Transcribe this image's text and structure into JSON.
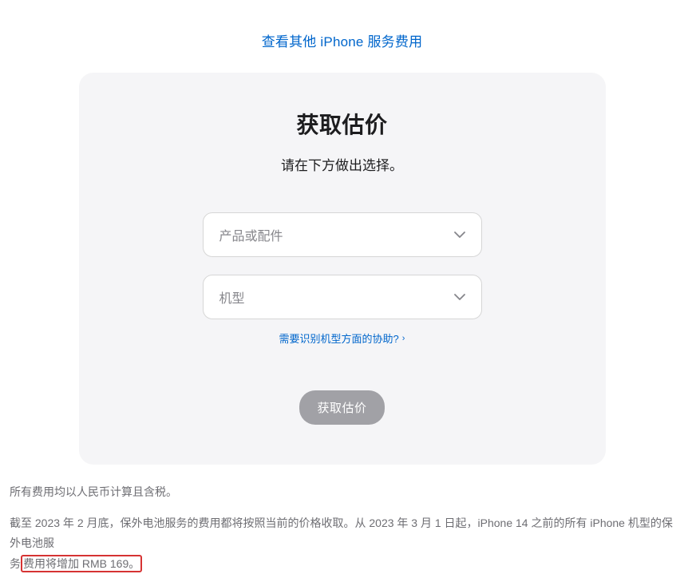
{
  "top_link": {
    "label": "查看其他 iPhone 服务费用"
  },
  "card": {
    "title": "获取估价",
    "subtitle": "请在下方做出选择。",
    "select_product_placeholder": "产品或配件",
    "select_model_placeholder": "机型",
    "help_link_label": "需要识别机型方面的协助?",
    "submit_button_label": "获取估价"
  },
  "footer": {
    "tax_note": "所有费用均以人民币计算且含税。",
    "notice_part1": "截至 2023 年 2 月底，保外电池服务的费用都将按照当前的价格收取。从 2023 年 3 月 1 日起，iPhone 14 之前的所有 iPhone 机型的保外电池服",
    "notice_part2_prefix": "务",
    "notice_highlight": "费用将增加 RMB 169。"
  }
}
